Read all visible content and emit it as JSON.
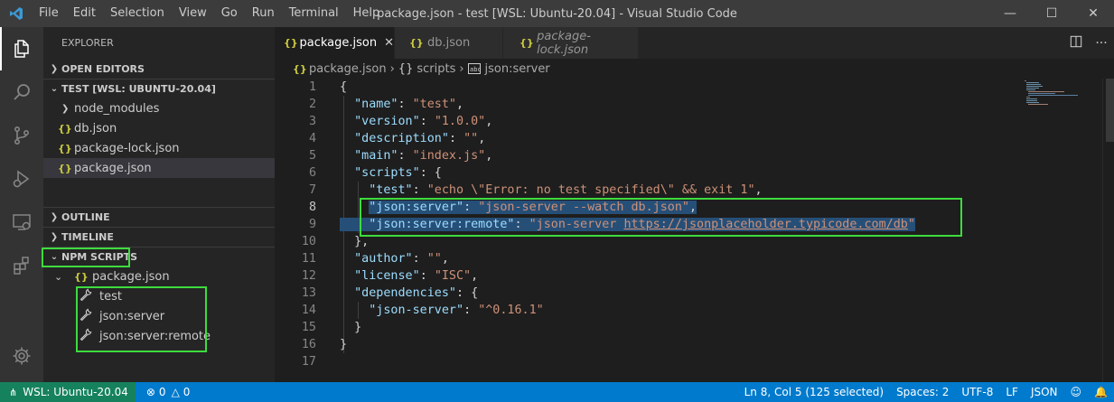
{
  "window": {
    "title": "package.json - test [WSL: Ubuntu-20.04] - Visual Studio Code",
    "menu": [
      "File",
      "Edit",
      "Selection",
      "View",
      "Go",
      "Run",
      "Terminal",
      "Help"
    ]
  },
  "sidebar": {
    "title": "EXPLORER",
    "open_editors": "OPEN EDITORS",
    "workspace": "TEST [WSL: UBUNTU-20.04]",
    "files": [
      "node_modules",
      "db.json",
      "package-lock.json",
      "package.json"
    ],
    "outline": "OUTLINE",
    "timeline": "TIMELINE",
    "npm_scripts": "NPM SCRIPTS",
    "npm_package": "package.json",
    "scripts": [
      "test",
      "json:server",
      "json:server:remote"
    ]
  },
  "tabs": [
    {
      "label": "package.json",
      "active": true
    },
    {
      "label": "db.json",
      "active": false
    },
    {
      "label": "package-lock.json",
      "active": false,
      "italic": true
    }
  ],
  "breadcrumb": {
    "file": "package.json",
    "scripts": "scripts",
    "key": "json:server"
  },
  "editor": {
    "line_numbers": [
      "1",
      "2",
      "3",
      "4",
      "5",
      "6",
      "7",
      "8",
      "9",
      "10",
      "11",
      "12",
      "13",
      "14",
      "15",
      "16",
      "17"
    ],
    "lines": [
      "{",
      "  \"name\": \"test\",",
      "  \"version\": \"1.0.0\",",
      "  \"description\": \"\",",
      "  \"main\": \"index.js\",",
      "  \"scripts\": {",
      "    \"test\": \"echo \\\"Error: no test specified\\\" && exit 1\",",
      "    \"json:server\": \"json-server --watch db.json\",",
      "    \"json:server:remote\": \"json-server https://jsonplaceholder.typicode.com/db\"",
      "  },",
      "  \"author\": \"\",",
      "  \"license\": \"ISC\",",
      "  \"dependencies\": {",
      "    \"json-server\": \"^0.16.1\"",
      "  }",
      "}",
      ""
    ]
  },
  "statusbar": {
    "remote": "WSL: Ubuntu-20.04",
    "problems_errors": "0",
    "problems_warnings": "0",
    "position": "Ln 8, Col 5 (125 selected)",
    "spaces": "Spaces: 2",
    "encoding": "UTF-8",
    "eol": "LF",
    "language": "JSON"
  },
  "colors": {
    "accent": "#007acc",
    "remote": "#16825d",
    "highlight_box": "#3ddc3d",
    "selection": "#264f78"
  }
}
